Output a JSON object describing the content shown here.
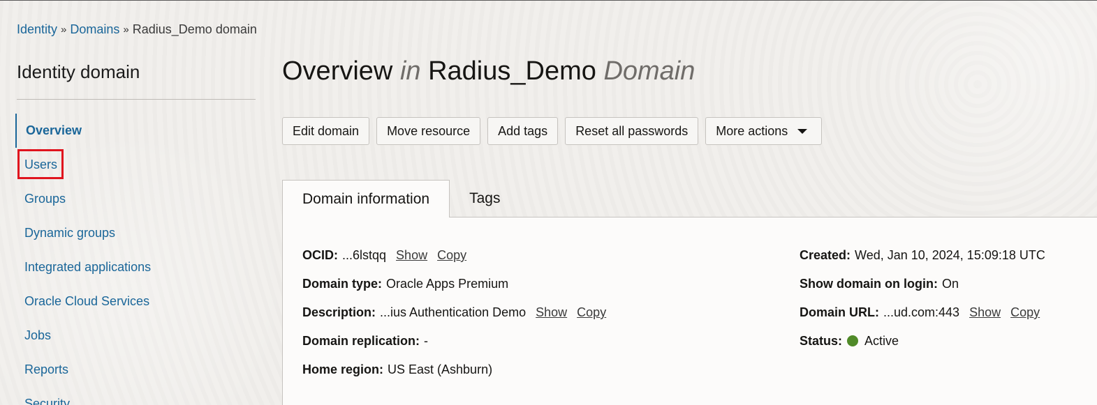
{
  "breadcrumb": {
    "items": [
      "Identity",
      "Domains"
    ],
    "separator": "»",
    "current": "Radius_Demo domain"
  },
  "sidebar": {
    "title": "Identity domain",
    "items": [
      {
        "label": "Overview",
        "active": true
      },
      {
        "label": "Users",
        "highlighted": true
      },
      {
        "label": "Groups"
      },
      {
        "label": "Dynamic groups"
      },
      {
        "label": "Integrated applications"
      },
      {
        "label": "Oracle Cloud Services"
      },
      {
        "label": "Jobs"
      },
      {
        "label": "Reports"
      },
      {
        "label": "Security"
      }
    ]
  },
  "page": {
    "title_part1": "Overview",
    "title_in": "in",
    "title_name": "Radius_Demo",
    "title_domain": "Domain"
  },
  "actions": {
    "edit_domain": "Edit domain",
    "move_resource": "Move resource",
    "add_tags": "Add tags",
    "reset_passwords": "Reset all passwords",
    "more_actions": "More actions"
  },
  "tabs": [
    {
      "label": "Domain information",
      "active": true
    },
    {
      "label": "Tags"
    }
  ],
  "info": {
    "ocid_label": "OCID:",
    "ocid_value": "...6lstqq",
    "domain_type_label": "Domain type:",
    "domain_type_value": "Oracle Apps Premium",
    "description_label": "Description:",
    "description_value": "...ius Authentication Demo",
    "replication_label": "Domain replication:",
    "replication_value": "-",
    "home_region_label": "Home region:",
    "home_region_value": "US East (Ashburn)",
    "created_label": "Created:",
    "created_value": "Wed, Jan 10, 2024, 15:09:18 UTC",
    "show_on_login_label": "Show domain on login:",
    "show_on_login_value": "On",
    "url_label": "Domain URL:",
    "url_value": "...ud.com:443",
    "status_label": "Status:",
    "status_value": "Active",
    "show_link": "Show",
    "copy_link": "Copy"
  },
  "colors": {
    "link": "#1a6699",
    "status_active": "#508a28",
    "highlight": "#e0141e"
  }
}
